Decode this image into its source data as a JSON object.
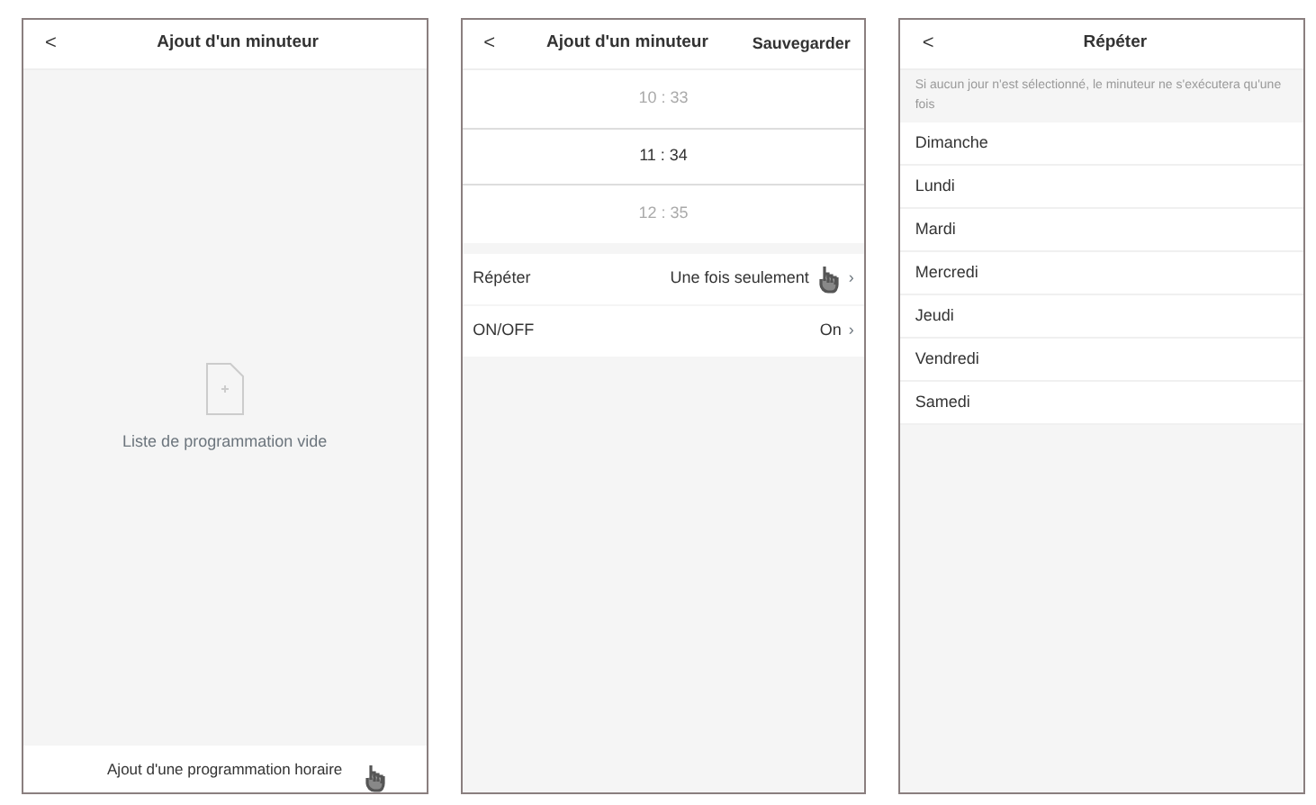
{
  "screens": [
    {
      "kind": "empty",
      "back": "<",
      "title": "Ajout d'un minuteur",
      "empty_text": "Liste de programmation vide",
      "add_button": "Ajout d'une programmation horaire"
    },
    {
      "kind": "edit",
      "back": "<",
      "title": "Ajout d'un minuteur",
      "save": "Sauvegarder",
      "picker": [
        {
          "hour": "10",
          "separator": ":",
          "minute": "33",
          "selected": false
        },
        {
          "hour": "11",
          "separator": ":",
          "minute": "34",
          "selected": true
        },
        {
          "hour": "12",
          "separator": ":",
          "minute": "35",
          "selected": false
        }
      ],
      "settings": [
        {
          "label": "Répéter",
          "value": "Une fois seulement",
          "chevron": "›",
          "pointer": true
        },
        {
          "label": "ON/OFF",
          "value": "On",
          "chevron": "›",
          "pointer": false
        }
      ]
    },
    {
      "kind": "repeat",
      "back": "<",
      "title": "Répéter",
      "hint": "Si aucun jour n'est sélectionné, le minuteur ne s'exécutera qu'une fois",
      "days": [
        "Dimanche",
        "Lundi",
        "Mardi",
        "Mercredi",
        "Jeudi",
        "Vendredi",
        "Samedi"
      ]
    }
  ]
}
